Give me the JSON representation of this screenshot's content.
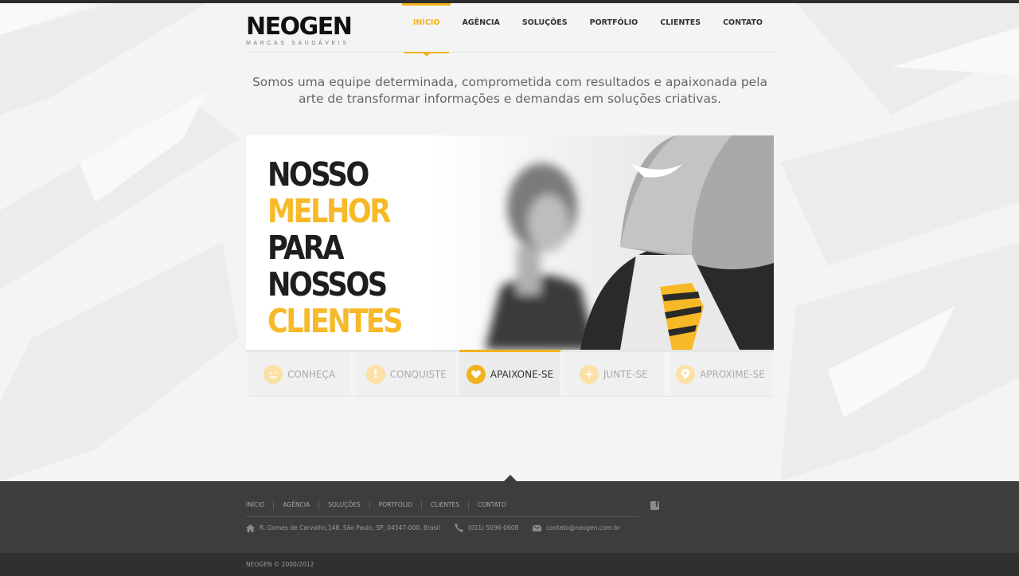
{
  "brand": {
    "name": "NEOGEN",
    "tagline": "MARCAS SAUDÁVEIS",
    "accent_color": "#f2b21c"
  },
  "nav": {
    "items": [
      {
        "label": "INÍCIO",
        "active": true
      },
      {
        "label": "AGÊNCIA",
        "active": false
      },
      {
        "label": "SOLUÇÕES",
        "active": false
      },
      {
        "label": "PORTFÓLIO",
        "active": false
      },
      {
        "label": "CLIENTES",
        "active": false
      },
      {
        "label": "CONTATO",
        "active": false
      }
    ]
  },
  "intro": {
    "text": "Somos uma equipe determinada, comprometida com resultados e apaixonada pela arte de transformar informações e demandas em soluções criativas."
  },
  "banner": {
    "line1": "NOSSO",
    "line2": "MELHOR",
    "line3": "PARA",
    "line4": "NOSSOS",
    "line5": "CLIENTES"
  },
  "tabs": {
    "items": [
      {
        "label": "CONHEÇA",
        "icon": "smiley-icon",
        "active": false
      },
      {
        "label": "CONQUISTE",
        "icon": "exclamation-icon",
        "active": false
      },
      {
        "label": "APAIXONE-SE",
        "icon": "heart-icon",
        "active": true
      },
      {
        "label": "JUNTE-SE",
        "icon": "plus-icon",
        "active": false
      },
      {
        "label": "APROXIME-SE",
        "icon": "location-pin-icon",
        "active": false
      }
    ]
  },
  "footer": {
    "nav": [
      "INÍCIO",
      "AGÊNCIA",
      "SOLUÇÕES",
      "PORTFÓLIO",
      "CLIENTES",
      "CONTATO"
    ],
    "address": "R. Gomes de Carvalho,148. São Paulo, SP, 04547-000. Brasil",
    "phone": "(011) 5096-0608",
    "email": "contato@neogen.com.br",
    "copyright": "NEOGEN © 2000/2012"
  }
}
